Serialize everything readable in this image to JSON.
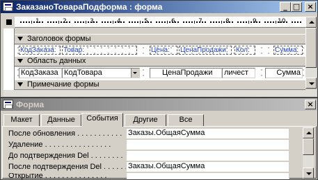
{
  "form_window": {
    "title": "ЗаказаноТовараПодформа : форма",
    "minimize_glyph": "_",
    "maximize_glyph": "□",
    "close_glyph": "×",
    "ruler_numbers": [
      "1",
      "2",
      "3",
      "4",
      "5",
      "6",
      "7",
      "8",
      "9",
      "10"
    ],
    "sections": {
      "header": "Заголовок формы",
      "detail": "Область данных",
      "footer": "Примечание формы"
    },
    "header_labels": [
      "КодЗаказа:",
      "Товар:",
      "Цена:",
      "ЦенаПродажи:",
      "Кол:",
      "Сумма:"
    ],
    "detail_fields": [
      "КодЗаказа",
      "КодТовара",
      "ЦенаПродажи",
      "личест",
      "Сумма"
    ]
  },
  "properties_window": {
    "title": "Форма",
    "close_glyph": "×",
    "tabs": [
      "Макет",
      "Данные",
      "События",
      "Другие",
      "Все"
    ],
    "active_tab": "События",
    "properties": [
      {
        "label": "После обновления . . . . . . . . . . .",
        "value": "Заказы.ОбщаяСумма"
      },
      {
        "label": "Удаление . . . . . . . . . . . . . . . .",
        "value": ""
      },
      {
        "label": "До подтверждения Del . . . . . . . .",
        "value": ""
      },
      {
        "label": "После подтверждения Del . . . . . .",
        "value": "Заказы.ОбщаяСумма"
      },
      {
        "label": "Открытие . . . . . . . . . . . . . . .",
        "value": ""
      }
    ]
  }
}
